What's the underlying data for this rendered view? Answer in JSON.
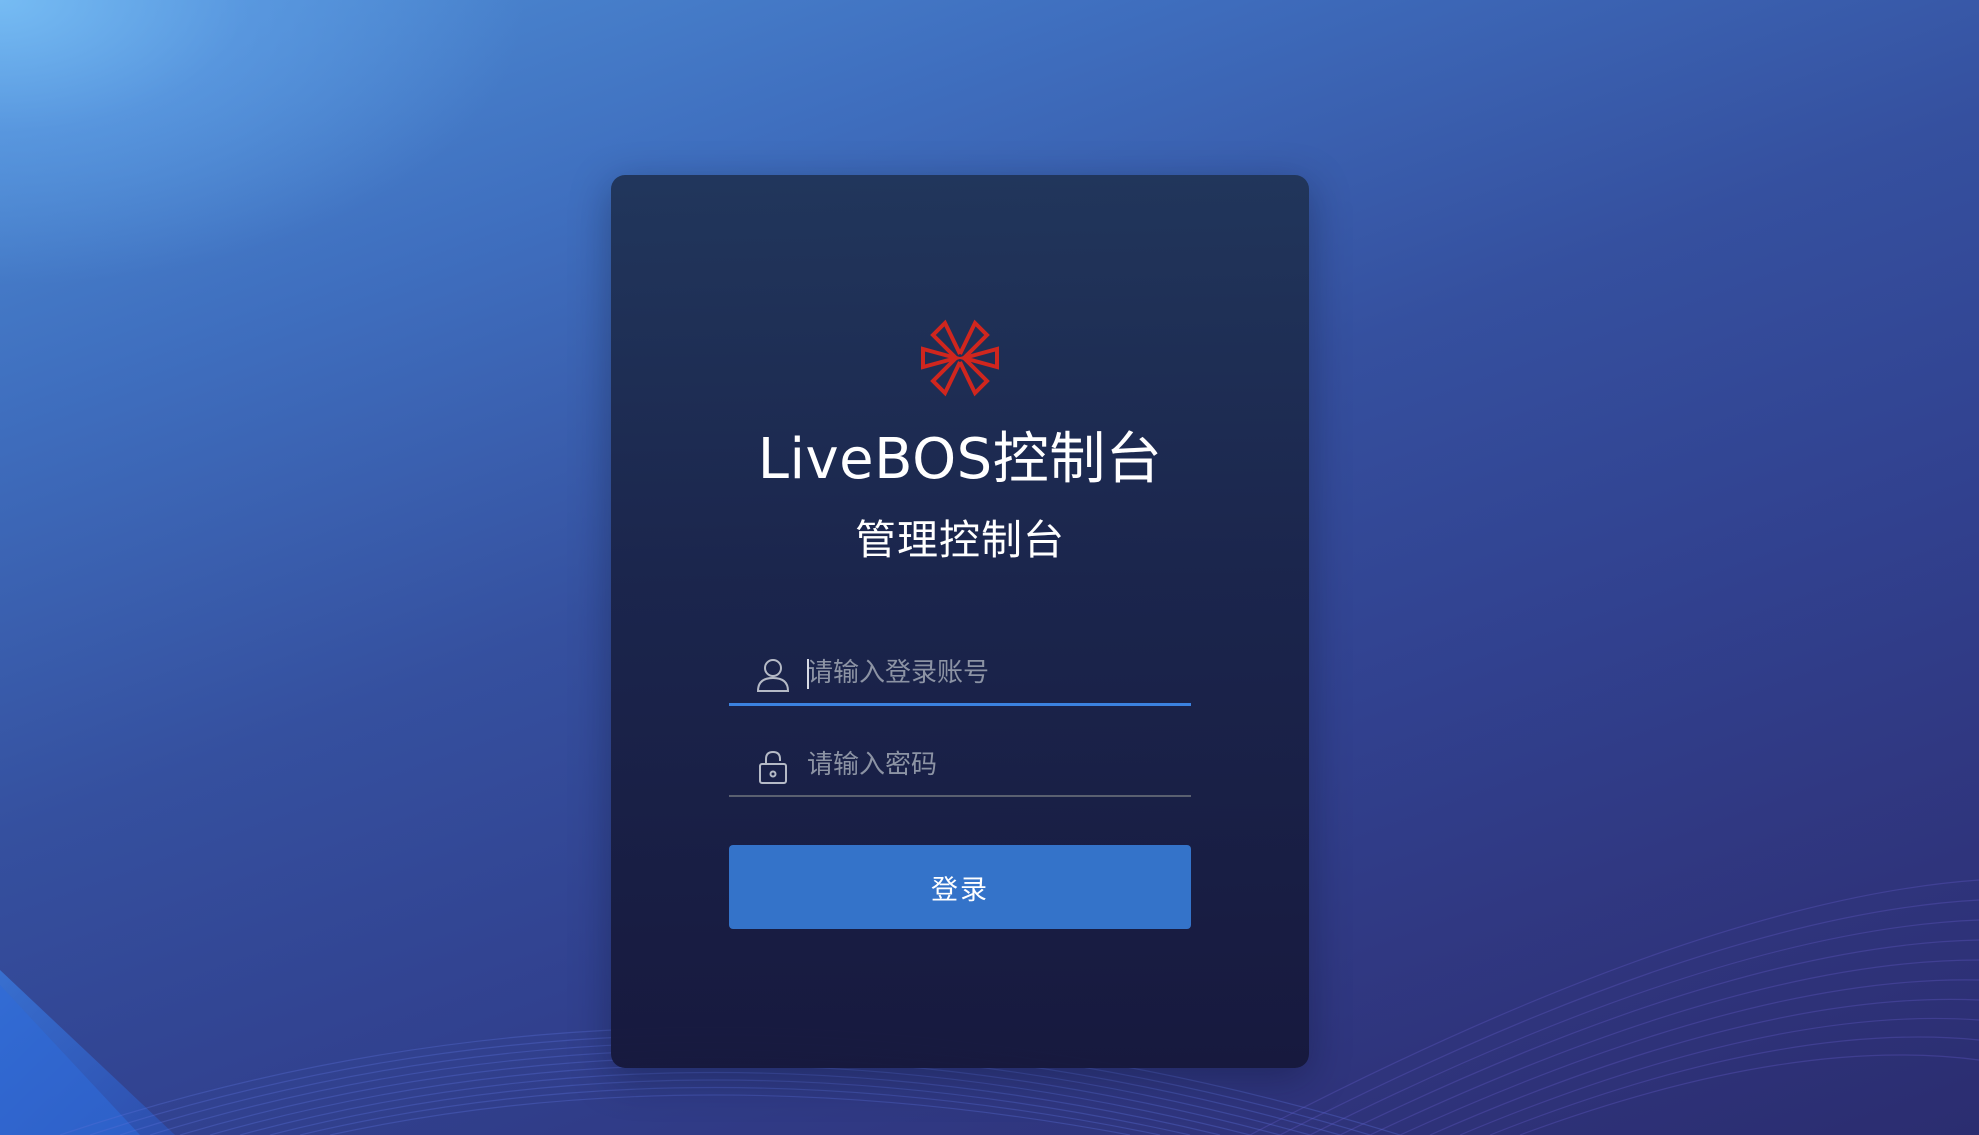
{
  "app": {
    "title": "LiveBOS控制台",
    "subtitle": "管理控制台",
    "logo_icon": "livebos-logo-icon",
    "logo_color": "#d0261e"
  },
  "login_form": {
    "account": {
      "icon": "user-icon",
      "placeholder": "请输入登录账号",
      "value": ""
    },
    "password": {
      "icon": "lock-icon",
      "placeholder": "请输入密码",
      "value": ""
    },
    "submit_label": "登录"
  },
  "colors": {
    "accent": "#3473c9",
    "active_underline": "#3b82e0",
    "card_background": "#1c2450"
  }
}
